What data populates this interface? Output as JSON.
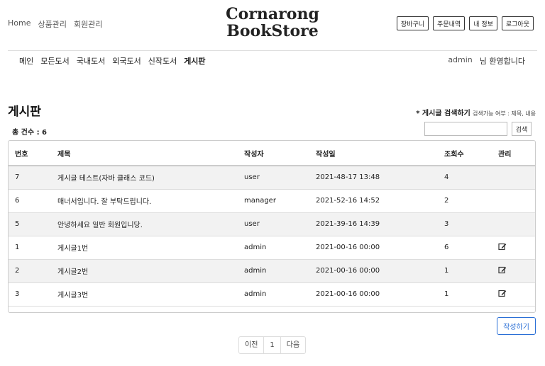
{
  "header": {
    "top_links": [
      "Home",
      "상품관리",
      "회원관리"
    ],
    "brand_line1": "Cornarong",
    "brand_line2": "BookStore",
    "buttons": [
      "장바구니",
      "주문내역",
      "내 정보",
      "로그아웃"
    ]
  },
  "nav": {
    "items": [
      "메인",
      "모든도서",
      "국내도서",
      "외국도서",
      "신작도서",
      "게시판"
    ],
    "active_index": 5,
    "welcome_user": "admin",
    "welcome_text": "님 환영합니다"
  },
  "board": {
    "title": "게시판",
    "search_hint_label": "* 게시글 검색하기",
    "search_hint_note": "검색가능 여부 : 제목, 내용",
    "total_label": "총 건수 : 6",
    "search_value": "",
    "search_button": "검색",
    "columns": [
      "번호",
      "제목",
      "작성자",
      "작성일",
      "조회수",
      "관리"
    ],
    "rows": [
      {
        "no": "7",
        "title": "게시글 테스트(자바 클래스 코드)",
        "author": "user",
        "date": "2021-48-17 13:48",
        "views": "4",
        "editable": false
      },
      {
        "no": "6",
        "title": "매너서입니다. 잘 부탁드립니다.",
        "author": "manager",
        "date": "2021-52-16 14:52",
        "views": "2",
        "editable": false
      },
      {
        "no": "5",
        "title": "안녕하세요 일반 회원입니당.",
        "author": "user",
        "date": "2021-39-16 14:39",
        "views": "3",
        "editable": false
      },
      {
        "no": "1",
        "title": "게시글1번",
        "author": "admin",
        "date": "2021-00-16 00:00",
        "views": "6",
        "editable": true
      },
      {
        "no": "2",
        "title": "게시글2번",
        "author": "admin",
        "date": "2021-00-16 00:00",
        "views": "1",
        "editable": true
      },
      {
        "no": "3",
        "title": "게시글3번",
        "author": "admin",
        "date": "2021-00-16 00:00",
        "views": "1",
        "editable": true
      }
    ],
    "edit_icon": "edit-icon",
    "write_button": "작성하기"
  },
  "pagination": {
    "prev": "이전",
    "current": "1",
    "next": "다음"
  }
}
